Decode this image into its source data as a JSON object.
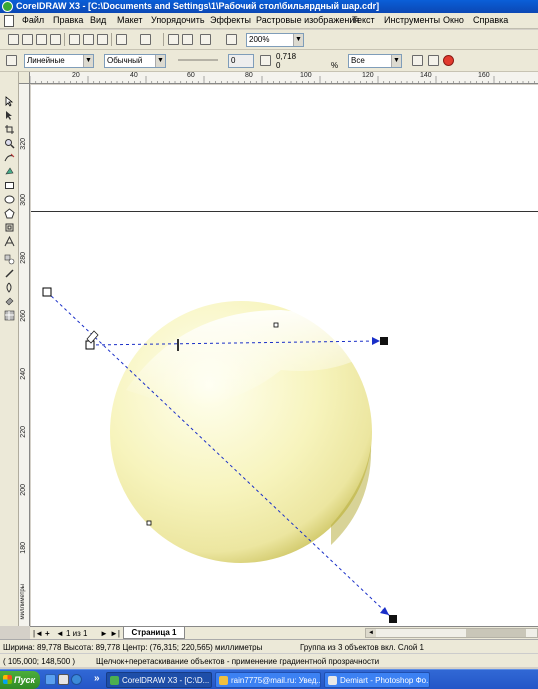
{
  "window": {
    "title": "CorelDRAW X3 - [C:\\Documents and Settings\\1\\Рабочий стол\\бильярдный шар.cdr]"
  },
  "menu": {
    "items": [
      "Файл",
      "Правка",
      "Вид",
      "Макет",
      "Упорядочить",
      "Эффекты",
      "Растровые изображения",
      "Текст",
      "Инструменты",
      "Окно",
      "Справка"
    ]
  },
  "toolbar": {
    "zoom_value": "200%"
  },
  "property_bar": {
    "fill_type": "Линейные",
    "mode": "Обычный",
    "midpoint": "0",
    "transparency_value": "0,718",
    "edge_pad": "0",
    "percent_sign": "%",
    "apply_to": "Все"
  },
  "rulers": {
    "horizontal_labels": [
      "20",
      "40",
      "60",
      "80",
      "100",
      "120",
      "140",
      "160"
    ],
    "vertical_labels": [
      "320",
      "300",
      "280",
      "260",
      "240",
      "220",
      "200",
      "180"
    ],
    "vertical_unit": "миллиметры"
  },
  "page_nav": {
    "first": "|◄",
    "prev": "◄",
    "add_before": "+",
    "page_count": "1 из 1",
    "next": "►",
    "last": "►|",
    "page_tab": "Страница 1"
  },
  "status": {
    "line1": "Ширина: 89,778  Высота: 89,778  Центр: (76,315; 220,565)  миллиметры",
    "selection": "Группа из 3 объектов вкл. Слой 1",
    "coords": "( 105,000; 148,500 )",
    "hint": "Щелчок+перетаскивание объектов - применение градиентной прозрачности"
  },
  "taskbar": {
    "start": "Пуск",
    "tasks": [
      {
        "label": "CorelDRAW X3 - [C:\\D...",
        "active": true
      },
      {
        "label": "rain7775@mail.ru: Увед...",
        "active": false
      },
      {
        "label": "Demiart - Photoshop Фо...",
        "active": false
      }
    ],
    "overflow": "»"
  },
  "colors": {
    "title_bar": "#0b52c9",
    "ball_fill": "#f6f3b8",
    "ball_shadow": "#c6be55",
    "handle_line": "#1a2fc8",
    "taskbar": "#2a5fd0",
    "start_button": "#3b9b2e"
  }
}
